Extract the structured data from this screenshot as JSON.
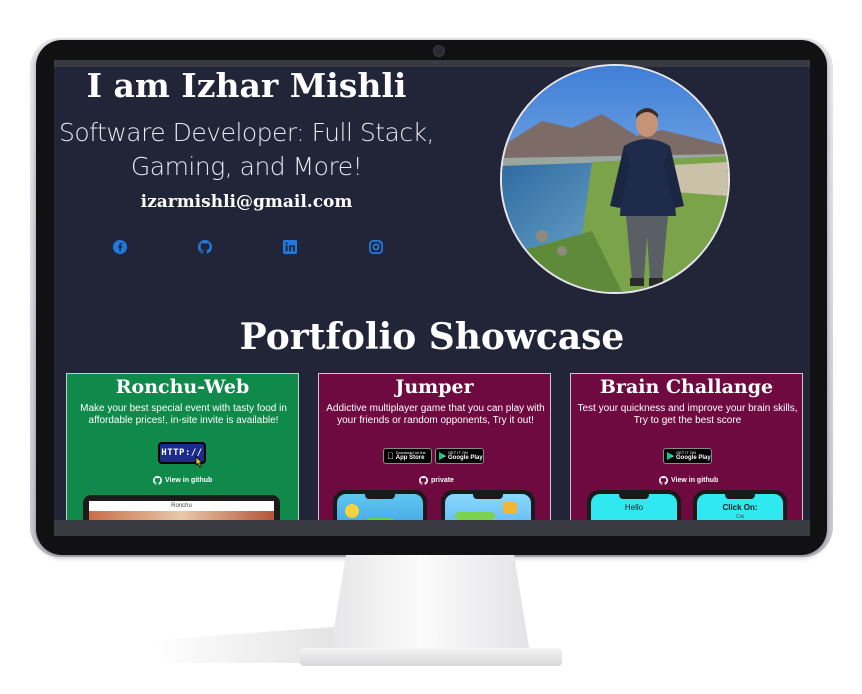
{
  "hero": {
    "name": "I am Izhar Mishli",
    "role_line1": "Software Developer: Full Stack,",
    "role_line2": "Gaming, and More!",
    "email": "izarmishli@gmail.com",
    "social_icons": [
      "facebook-icon",
      "github-icon",
      "linkedin-icon",
      "instagram-icon"
    ],
    "accent_color": "#1f7ae0"
  },
  "portfolio": {
    "title": "Portfolio Showcase",
    "projects": [
      {
        "title": "Ronchu-Web",
        "description": "Make your best special event with tasty food in affordable prices!, in-site invite is available!",
        "http_label": "HTTP://",
        "link_label": "View in github",
        "preview_title": "Ronchu",
        "color": "#0f8a4a"
      },
      {
        "title": "Jumper",
        "description": "Addictive multiplayer game that you can play with your friends or random opponents, Try it out!",
        "appstore_small": "Download on the",
        "appstore_big": "App Store",
        "googleplay_small": "GET IT ON",
        "googleplay_big": "Google Play",
        "link_label": "private",
        "color": "#6e0a3f"
      },
      {
        "title": "Brain Challange",
        "description": "Test your quickness and improve your brain skills, Try to get the best score",
        "googleplay_small": "GET IT ON",
        "googleplay_big": "Google Play",
        "link_label": "View in github",
        "phone1_text": "Hello",
        "phone2_text": "Click On:",
        "phone2_sub": "Cat",
        "color": "#6e0a3f"
      }
    ]
  }
}
